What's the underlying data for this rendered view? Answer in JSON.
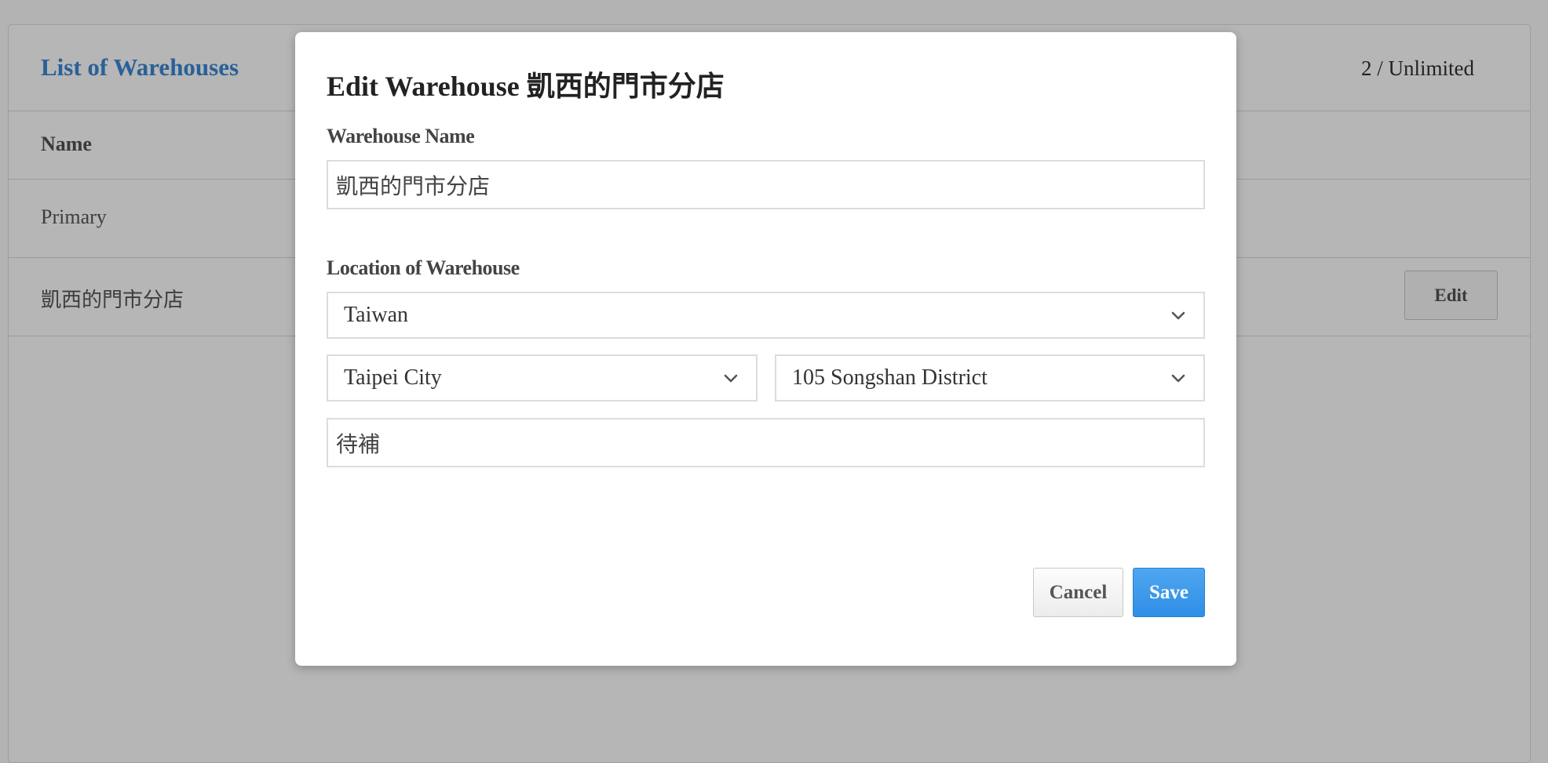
{
  "background": {
    "title": "List of Warehouses",
    "counter": "2 / Unlimited",
    "table": {
      "column_name": "Name",
      "rows": [
        {
          "name": "Primary"
        },
        {
          "name": "凱西的門市分店",
          "action": "Edit"
        }
      ]
    }
  },
  "modal": {
    "title": "Edit Warehouse 凱西的門市分店",
    "name_label": "Warehouse Name",
    "name_value": "凱西的門市分店",
    "location_label": "Location of Warehouse",
    "country": "Taiwan",
    "city": "Taipei City",
    "district": "105 Songshan District",
    "address": "待補",
    "cancel_label": "Cancel",
    "save_label": "Save"
  },
  "icons": {
    "select_chevron": "chevron-down-icon"
  },
  "colors": {
    "title_link": "#2a6099",
    "save_button": "#3b96ea",
    "overlay": "#b3b3b3"
  }
}
